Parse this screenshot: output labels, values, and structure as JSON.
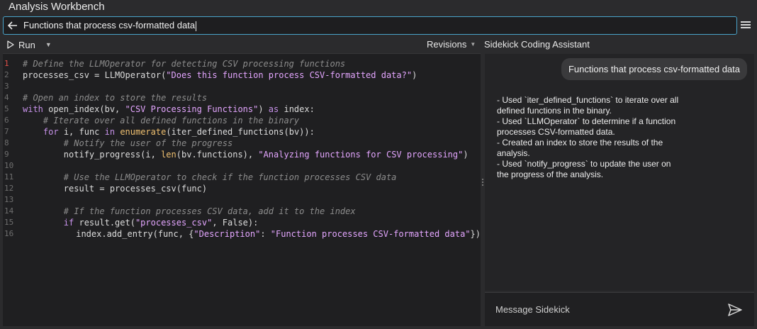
{
  "app": {
    "title": "Analysis Workbench"
  },
  "query": {
    "value": "Functions that process csv-formatted data"
  },
  "toolbar": {
    "run_label": "Run",
    "revisions_label": "Revisions"
  },
  "assistant": {
    "title": "Sidekick Coding Assistant",
    "user_message": "Functions that process csv-formatted data",
    "response_lines": [
      "- Used `iter_defined_functions` to iterate over all",
      "defined functions in the binary.",
      "- Used `LLMOperator` to determine if a function",
      "processes CSV-formatted data.",
      "- Created an index to store the results of the",
      "analysis.",
      "- Used `notify_progress` to update the user on",
      "the progress of the analysis."
    ],
    "message_placeholder": "Message Sidekick"
  },
  "code": {
    "line_numbers": [
      "1",
      "2",
      "3",
      "4",
      "5",
      "6",
      "7",
      "8",
      "9",
      "10",
      "11",
      "12",
      "13",
      "14",
      "15",
      "16"
    ],
    "lines": [
      "# Define the LLMOperator for detecting CSV processing functions",
      "processes_csv = LLMOperator(\"Does this function process CSV-formatted data?\")",
      "",
      "# Open an index to store the results",
      "with open_index(bv, \"CSV Processing Functions\") as index:",
      "    # Iterate over all defined functions in the binary",
      "    for i, func in enumerate(iter_defined_functions(bv)):",
      "        # Notify the user of the progress",
      "        notify_progress(i, len(bv.functions), \"Analyzing functions for CSV processing\")",
      "",
      "        # Use the LLMOperator to check if the function processes CSV data",
      "        result = processes_csv(func)",
      "",
      "        # If the function processes CSV data, add it to the index",
      "        if result.get(\"processes_csv\", False):",
      "            index.add_entry(func, {\"Description\": \"Function processes CSV-formatted data\"})"
    ]
  },
  "colors": {
    "accent": "#4aa3c9",
    "comment": "#8c8c8c",
    "keyword": "#c792ea",
    "string": "#e4a6ff",
    "builtin": "#f0c070",
    "active_line_number": "#e0504a"
  }
}
